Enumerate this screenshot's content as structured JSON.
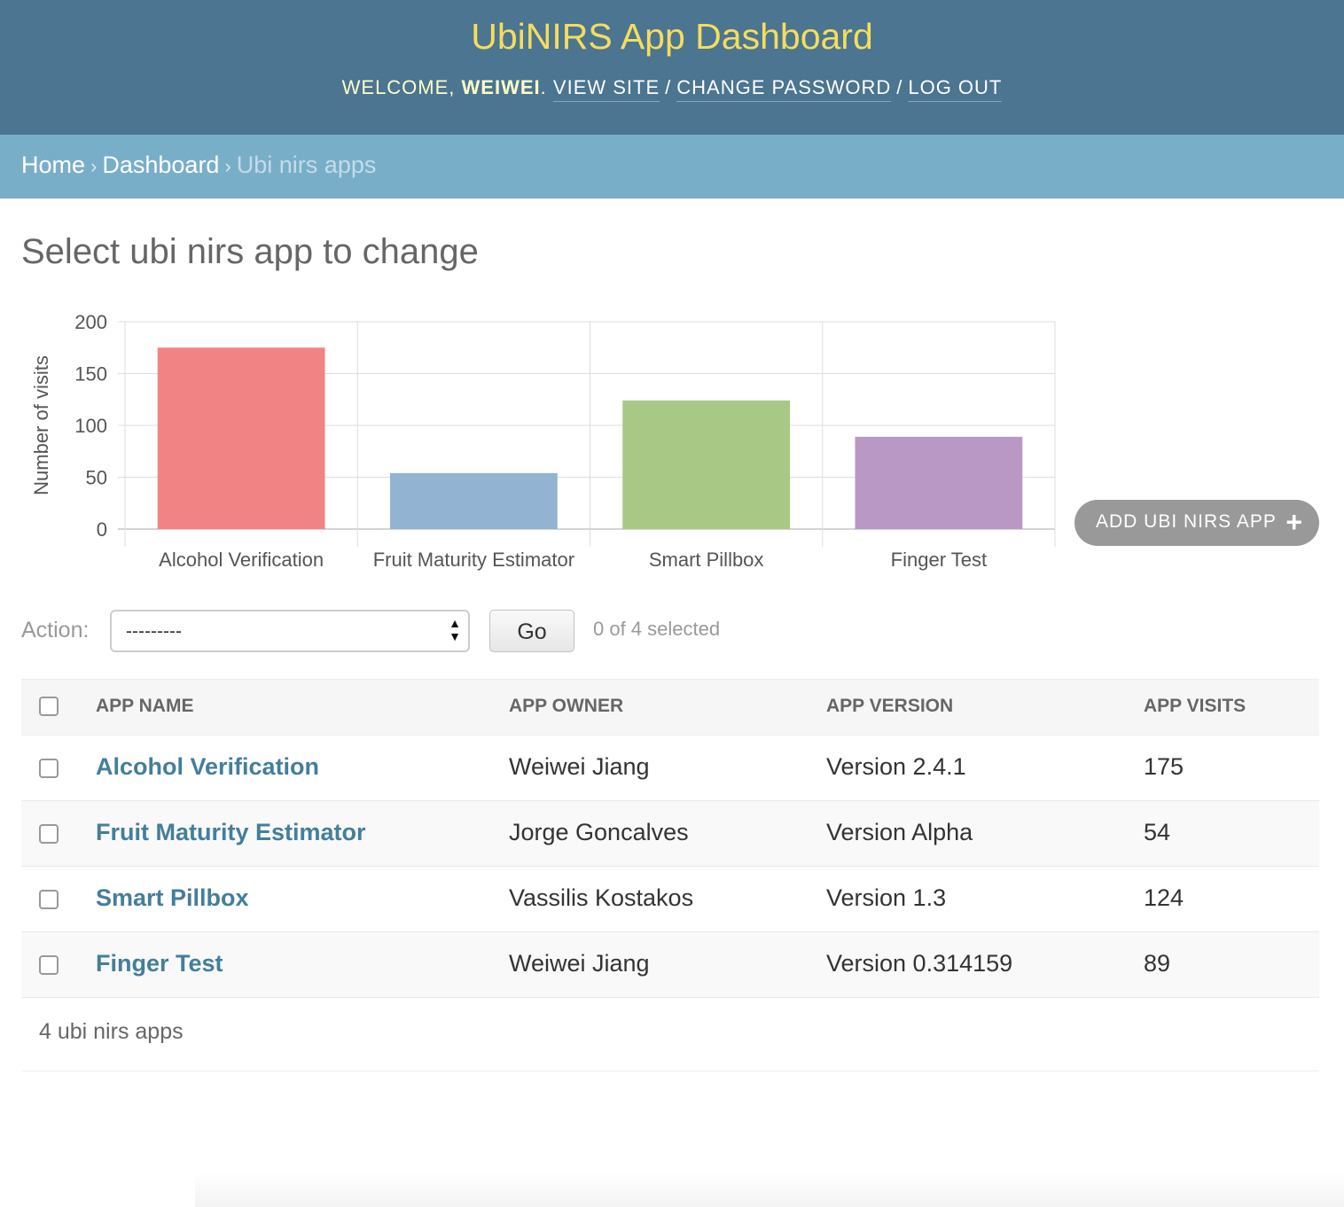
{
  "header": {
    "site_title": "UbiNIRS App Dashboard",
    "welcome": "Welcome,",
    "username": "weiwei",
    "view_site": "View site",
    "change_password": "Change password",
    "log_out": "Log out"
  },
  "breadcrumbs": {
    "home": "Home",
    "dashboard": "Dashboard",
    "current": "Ubi nirs apps",
    "separator": "›"
  },
  "page_title": "Select ubi nirs app to change",
  "chart_data": {
    "type": "bar",
    "categories": [
      "Alcohol Verification",
      "Fruit Maturity Estimator",
      "Smart Pillbox",
      "Finger Test"
    ],
    "values": [
      175,
      54,
      124,
      89
    ],
    "colors": [
      "#f28385",
      "#92b3d2",
      "#a8c886",
      "#b998c6"
    ],
    "ylabel": "Number of visits",
    "ylim": [
      0,
      200
    ],
    "yticks": [
      0,
      50,
      100,
      150,
      200
    ],
    "grid": true
  },
  "add_button": {
    "label": "Add ubi nirs app",
    "icon": "plus-icon"
  },
  "actions": {
    "label": "Action:",
    "selected_value": "---------",
    "go_label": "Go",
    "selected_count": "0 of 4 selected"
  },
  "table": {
    "headers": {
      "name": "App Name",
      "owner": "App Owner",
      "version": "App Version",
      "visits": "App Visits"
    },
    "rows": [
      {
        "name": "Alcohol Verification",
        "owner": "Weiwei Jiang",
        "version": "Version 2.4.1",
        "visits": "175"
      },
      {
        "name": "Fruit Maturity Estimator",
        "owner": "Jorge Goncalves",
        "version": "Version Alpha",
        "visits": "54"
      },
      {
        "name": "Smart Pillbox",
        "owner": "Vassilis Kostakos",
        "version": "Version 1.3",
        "visits": "124"
      },
      {
        "name": "Finger Test",
        "owner": "Weiwei Jiang",
        "version": "Version 0.314159",
        "visits": "89"
      }
    ]
  },
  "paginator": "4 ubi nirs apps"
}
